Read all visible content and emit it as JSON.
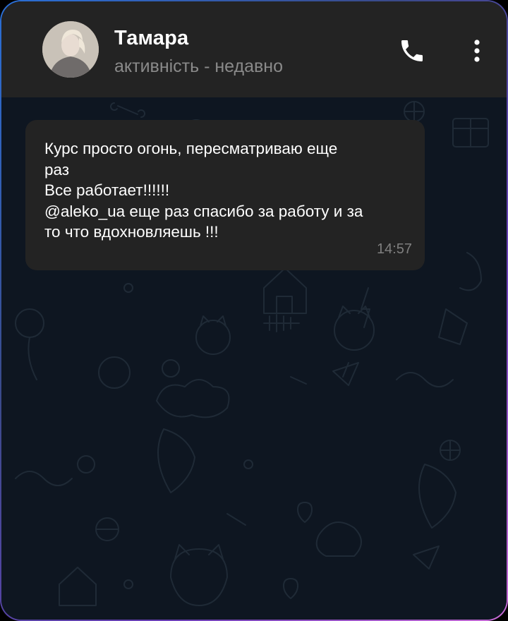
{
  "header": {
    "contact_name": "Тамара",
    "status": "активність - недавно",
    "call_icon": "phone-icon",
    "menu_icon": "more-vertical-icon"
  },
  "message": {
    "text": "Курс просто огонь, пересматриваю еще\nраз\nВсе работает!!!!!!\n@aleko_ua еще раз спасибо за работу и за\nто что вдохновляешь !!!",
    "time": "14:57"
  },
  "colors": {
    "header_bg": "#232323",
    "chat_bg": "#0e1621",
    "bubble_bg": "#232323",
    "text": "#ffffff",
    "muted": "#8a8a8a"
  }
}
